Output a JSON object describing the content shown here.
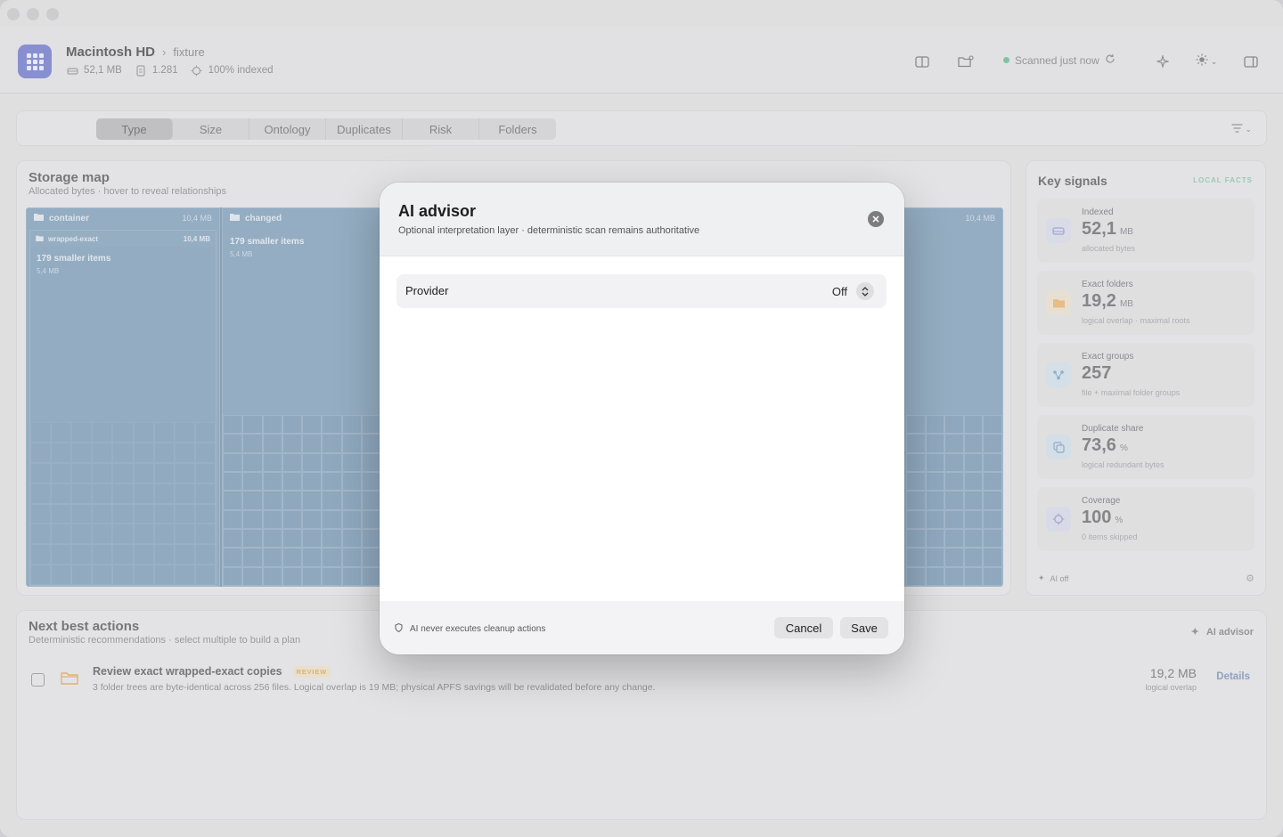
{
  "header": {
    "volume": "Macintosh HD",
    "separator": ">",
    "folder": "fixture",
    "size": "52,1 MB",
    "files": "1.281",
    "indexed": "100% indexed",
    "scan_status": "Scanned just now",
    "status_color": "#7fc9a8"
  },
  "tabs": [
    "Type",
    "Size",
    "Ontology",
    "Duplicates",
    "Risk",
    "Folders"
  ],
  "active_tab": "Type",
  "storage_map": {
    "title": "Storage map",
    "subtitle": "Allocated bytes · hover to reveal relationships",
    "blocks": [
      {
        "name": "container",
        "size": "10,4 MB"
      },
      {
        "name": "changed",
        "size": ""
      },
      {
        "name": "",
        "size": "10,4 MB"
      }
    ],
    "sub_block": {
      "name": "wrapped-exact",
      "size": "10,4 MB"
    },
    "smaller_items_label": "179 smaller items",
    "smaller_items_size": "5,4 MB",
    "accent_color": "#8ea7bd"
  },
  "key_signals": {
    "title": "Key signals",
    "tag": "LOCAL FACTS",
    "items": [
      {
        "label": "Indexed",
        "value": "52,1",
        "unit": "MB",
        "desc": "allocated bytes",
        "icon": "drive-icon"
      },
      {
        "label": "Exact folders",
        "value": "19,2",
        "unit": "MB",
        "desc": "logical overlap · maximal roots",
        "icon": "folder-icon"
      },
      {
        "label": "Exact groups",
        "value": "257",
        "unit": "",
        "desc": "file + maximal folder groups",
        "icon": "network-icon"
      },
      {
        "label": "Duplicate share",
        "value": "73,6",
        "unit": "%",
        "desc": "logical redundant bytes",
        "icon": "copy-icon"
      },
      {
        "label": "Coverage",
        "value": "100",
        "unit": "%",
        "desc": "0 items skipped",
        "icon": "target-icon"
      }
    ],
    "ai_status": "AI off"
  },
  "actions": {
    "title": "Next best actions",
    "subtitle": "Deterministic recommendations · select multiple to build a plan",
    "ai_button": "AI advisor",
    "rows": [
      {
        "title": "Review exact wrapped-exact copies",
        "badge": "REVIEW",
        "desc": "3 folder trees are byte-identical across 256 files. Logical overlap is 19 MB; physical APFS savings will be revalidated before any change.",
        "size": "19,2 MB",
        "size_sub": "logical overlap",
        "details": "Details"
      }
    ]
  },
  "dialog": {
    "title": "AI advisor",
    "subtitle": "Optional interpretation layer · deterministic scan remains authoritative",
    "provider_label": "Provider",
    "provider_value": "Off",
    "footer_note": "AI never executes cleanup actions",
    "cancel": "Cancel",
    "save": "Save"
  }
}
